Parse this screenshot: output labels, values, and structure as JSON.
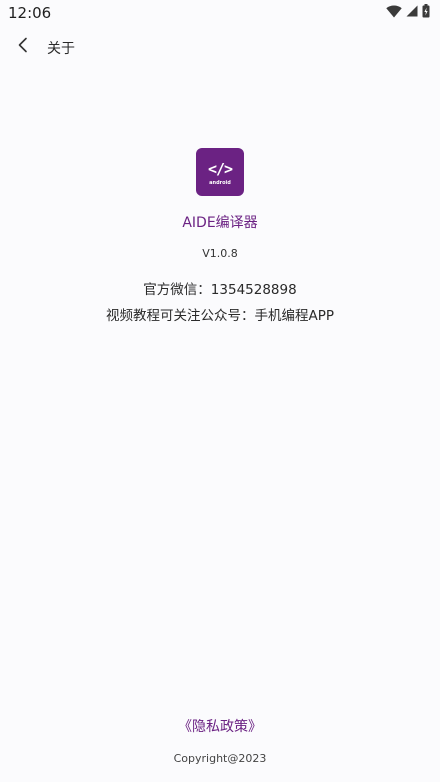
{
  "status_bar": {
    "time": "12:06",
    "icons": [
      "wifi-icon",
      "cell-signal-icon",
      "battery-charging-icon"
    ]
  },
  "app_bar": {
    "back_icon": "chevron-left-icon",
    "title": "关于"
  },
  "app_info": {
    "icon": {
      "name": "android-code-app-icon",
      "code_text": "</>",
      "sub_text": "android",
      "background": "#6b2283"
    },
    "name": "AIDE编译器",
    "version": "V1.0.8",
    "wechat": "官方微信：1354528898",
    "tutorial": "视频教程可关注公众号：手机编程APP"
  },
  "footer": {
    "privacy_link": "《隐私政策》",
    "copyright": "Copyright@2023"
  },
  "colors": {
    "accent": "#6b2283",
    "background": "#fbfbfd",
    "text": "#2a2a2a"
  }
}
